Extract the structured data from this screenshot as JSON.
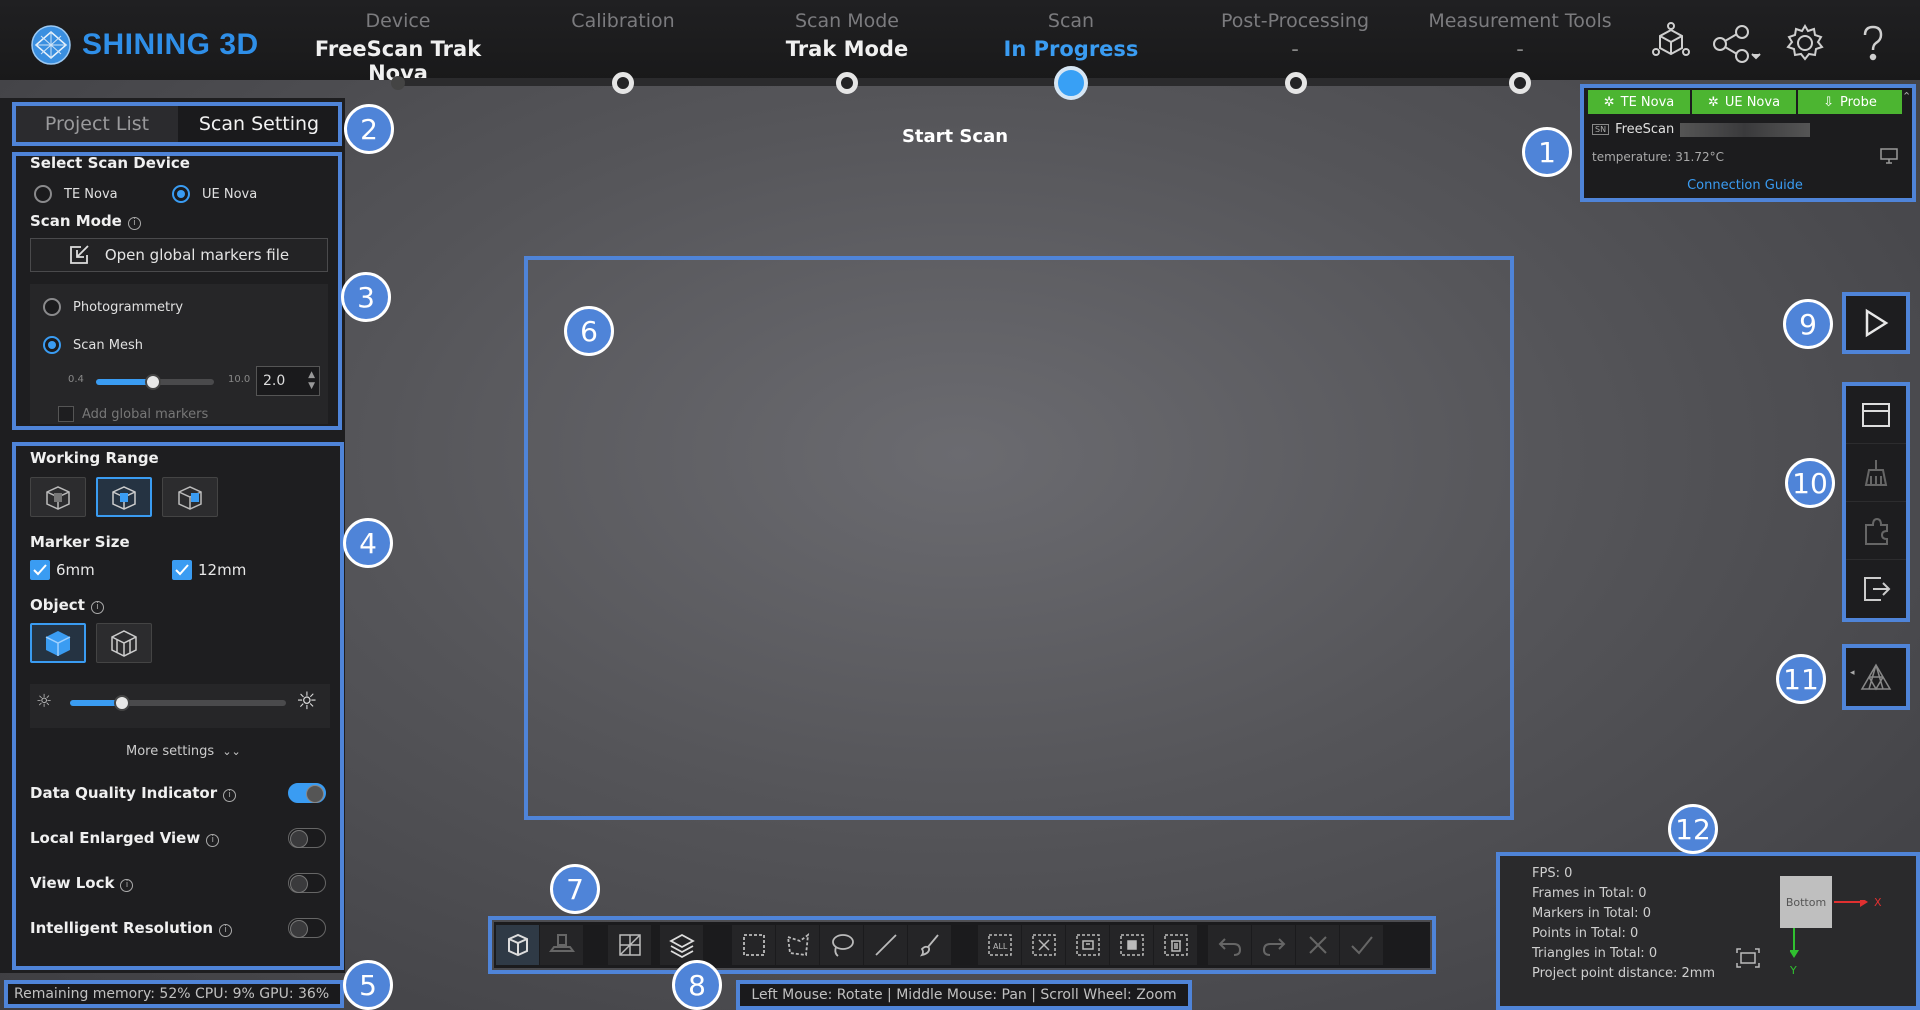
{
  "app": {
    "logo_text": "SHINING 3D",
    "accent_color": "#3a9cf2",
    "highlight_color": "#4f84d8",
    "device_tab_color": "#4cb531"
  },
  "steps": [
    {
      "label": "Device",
      "value": "FreeScan Trak Nova",
      "state": "done"
    },
    {
      "label": "Calibration",
      "value": "",
      "state": "idle"
    },
    {
      "label": "Scan Mode",
      "value": "Trak Mode",
      "state": "done"
    },
    {
      "label": "Scan",
      "value": "In Progress",
      "state": "active"
    },
    {
      "label": "Post-Processing",
      "value": "-",
      "state": "idle"
    },
    {
      "label": "Measurement Tools",
      "value": "-",
      "state": "idle"
    }
  ],
  "top_icons": [
    "cube-network-icon",
    "share-icon",
    "gear-icon",
    "help-icon"
  ],
  "left": {
    "tabs": [
      "Project List",
      "Scan Setting"
    ],
    "active_tab": "Scan Setting",
    "select_device_title": "Select Scan Device",
    "devices": [
      {
        "label": "TE Nova",
        "selected": false
      },
      {
        "label": "UE Nova",
        "selected": true
      }
    ],
    "scan_mode_title": "Scan Mode",
    "open_markers_label": "Open global markers file",
    "modes": [
      {
        "label": "Photogrammetry",
        "selected": false
      },
      {
        "label": "Scan Mesh",
        "selected": true
      }
    ],
    "resolution": {
      "min": "0.4",
      "max": "10.0",
      "value": "2.0",
      "fraction": 0.48
    },
    "add_global_markers": "Add global markers",
    "working_range_title": "Working Range",
    "working_range_selected": 1,
    "marker_size_title": "Marker Size",
    "marker_sizes": [
      {
        "label": "6mm",
        "checked": true
      },
      {
        "label": "12mm",
        "checked": true
      }
    ],
    "object_title": "Object",
    "object_selected": 0,
    "brightness_fraction": 0.24,
    "more_settings": "More settings",
    "toggles": [
      {
        "label": "Data Quality Indicator",
        "on": true
      },
      {
        "label": "Local Enlarged View",
        "on": false
      },
      {
        "label": "View Lock",
        "on": false
      },
      {
        "label": "Intelligent Resolution",
        "on": false
      }
    ],
    "status": "Remaining memory: 52% CPU: 9% GPU: 36%"
  },
  "center": {
    "start_scan": "Start Scan",
    "hint": "Left Mouse: Rotate | Middle Mouse: Pan | Scroll Wheel: Zoom"
  },
  "device_panel": {
    "tabs": [
      "TE Nova",
      "UE Nova",
      "Probe"
    ],
    "sn_badge": "SN",
    "serial": "FreeScan",
    "temperature": "temperature: 31.72°C",
    "guide": "Connection Guide"
  },
  "stats": {
    "lines": [
      "FPS: 0",
      "Frames in Total: 0",
      "Markers in Total: 0",
      "Points in Total: 0",
      "Triangles in Total: 0",
      "Project point distance: 2mm"
    ],
    "axis_label": "Bottom",
    "x_label": "X",
    "y_label": "Y"
  },
  "badges": [
    "1",
    "2",
    "3",
    "4",
    "5",
    "6",
    "7",
    "8",
    "9",
    "10",
    "11",
    "12"
  ]
}
